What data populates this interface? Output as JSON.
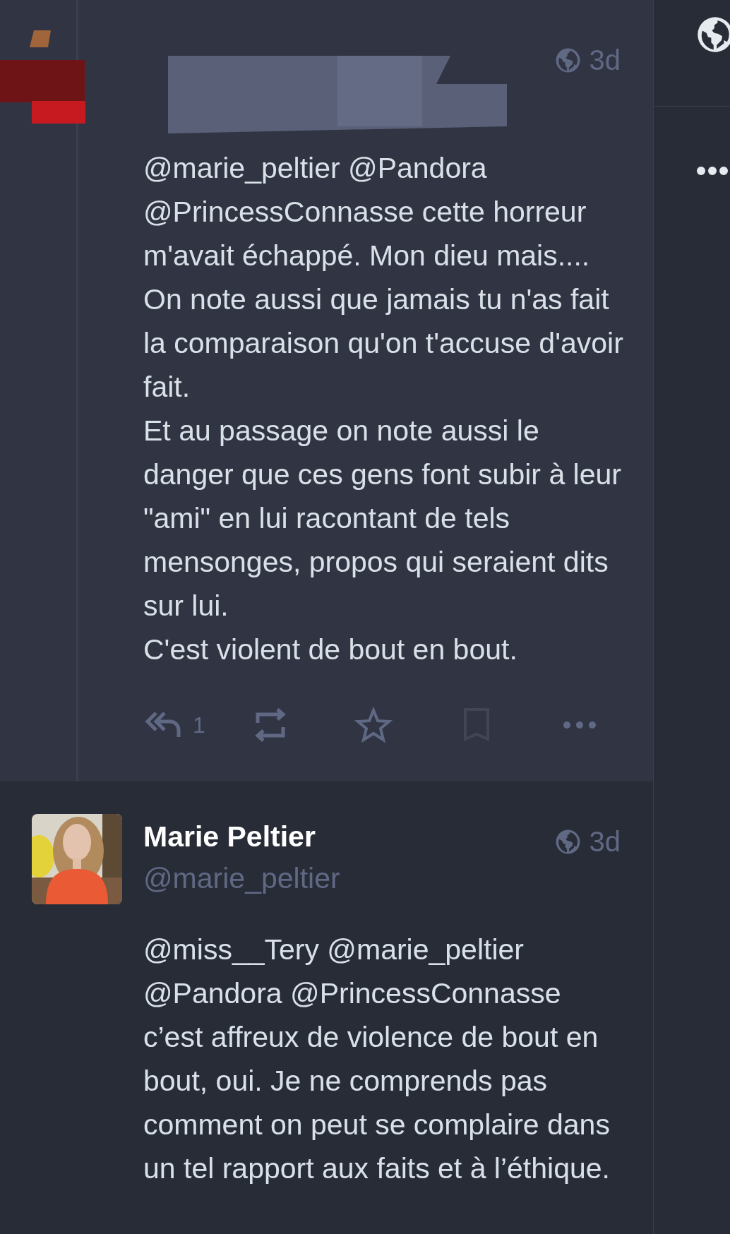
{
  "posts": [
    {
      "kind": "redacted",
      "time": "3d",
      "paragraphs": [
        [
          {
            "kind": "mention",
            "text": "@marie_peltier"
          },
          {
            "kind": "mention",
            "text": "@Pandora"
          },
          {
            "kind": "mention",
            "text": "@PrincessConnasse"
          },
          {
            "kind": "text",
            "text": " cette horreur m'avait échappé. Mon dieu mais.... On note aussi que jamais tu n'as fait la comparaison qu'on t'accuse d'avoir fait."
          }
        ],
        [
          {
            "kind": "text",
            "text": "Et au passage on note aussi le danger que ces gens font subir à leur \"ami\" en lui racontant de tels mensonges, propos qui seraient dits sur lui."
          }
        ],
        [
          {
            "kind": "text",
            "text": "C'est violent de bout en bout."
          }
        ]
      ],
      "actions": {
        "reply_count": "1"
      }
    },
    {
      "kind": "named",
      "name": "Marie Peltier",
      "handle": "@marie_peltier",
      "time": "3d",
      "paragraphs": [
        [
          {
            "kind": "mention",
            "text": "@miss__Tery"
          },
          {
            "kind": "mention",
            "text": "@marie_peltier"
          },
          {
            "kind": "mention",
            "text": "@Pandora"
          },
          {
            "kind": "mention",
            "text": "@PrincessConnasse"
          },
          {
            "kind": "text",
            "text": " c’est affreux de violence de bout en bout, oui. Je ne comprends pas comment on peut se complaire dans un tel rapport aux faits et à l’éthique."
          }
        ]
      ]
    }
  ],
  "sidebar": {
    "items": [
      {
        "kind": "globe"
      },
      {
        "kind": "more"
      }
    ]
  }
}
